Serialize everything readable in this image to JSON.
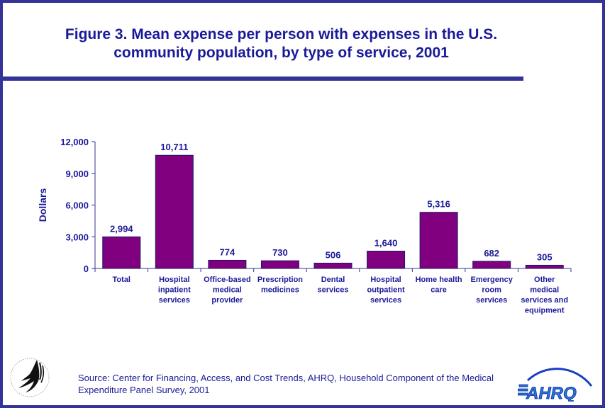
{
  "colors": {
    "border": "#333399",
    "text": "#1a1a99",
    "bar_fill": "#800080",
    "bar_stroke": "#1a1a66"
  },
  "header": {
    "title_line1": "Figure 3. Mean expense per person with expenses in the U.S.",
    "title_line2": "community population, by type of service, 2001"
  },
  "footer": {
    "source_line1": "Source: Center for Financing, Access, and Cost Trends, AHRQ, Household Component of the Medical",
    "source_line2": "Expenditure Panel Survey, 2001",
    "left_logo": "hhs-eagle-logo",
    "right_logo": "ahrq-logo",
    "right_logo_text": "AHRQ"
  },
  "chart_data": {
    "type": "bar",
    "title": "Figure 3. Mean expense per person with expenses in the U.S. community population, by type of service, 2001",
    "xlabel": "",
    "ylabel": "Dollars",
    "ylim": [
      0,
      12000
    ],
    "yticks": [
      0,
      3000,
      6000,
      9000,
      12000
    ],
    "ytick_labels": [
      "0",
      "3,000",
      "6,000",
      "9,000",
      "12,000"
    ],
    "grid": false,
    "legend": "none",
    "categories": [
      [
        "Total"
      ],
      [
        "Hospital",
        "inpatient",
        "services"
      ],
      [
        "Office-based",
        "medical",
        "provider"
      ],
      [
        "Prescription",
        "medicines"
      ],
      [
        "Dental",
        "services"
      ],
      [
        "Hospital",
        "outpatient",
        "services"
      ],
      [
        "Home health",
        "care"
      ],
      [
        "Emergency",
        "room",
        "services"
      ],
      [
        "Other",
        "medical",
        "services and",
        "equipment"
      ]
    ],
    "values": [
      2994,
      10711,
      774,
      730,
      506,
      1640,
      5316,
      682,
      305
    ],
    "value_labels": [
      "2,994",
      "10,711",
      "774",
      "730",
      "506",
      "1,640",
      "5,316",
      "682",
      "305"
    ]
  }
}
